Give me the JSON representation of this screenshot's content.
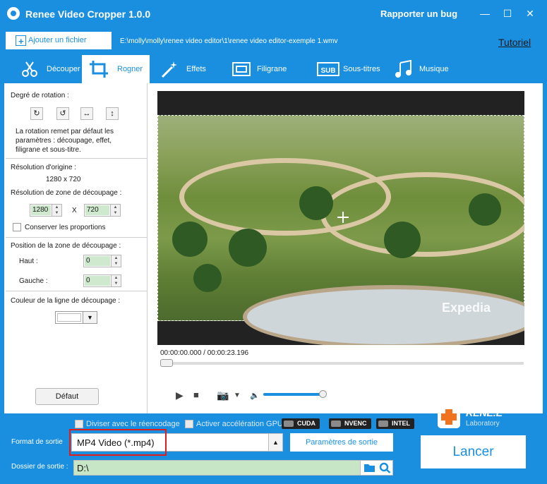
{
  "titlebar": {
    "title": "Renee Video Cropper 1.0.0",
    "bug_link": "Rapporter un bug",
    "buttons": [
      "minimize-icon",
      "maximize-icon",
      "close-icon"
    ]
  },
  "file_row": {
    "add_file": "Ajouter un fichier",
    "path": "E:\\molly\\molly\\renee video editor\\1\\renee video editor-exemple 1.wmv",
    "tutorial": "Tutoriel"
  },
  "tabs": [
    {
      "label": "Découper",
      "icon": "scissors-icon"
    },
    {
      "label": "Rogner",
      "icon": "crop-icon",
      "active": true
    },
    {
      "label": "Effets",
      "icon": "magic-wand-icon"
    },
    {
      "label": "Filigrane",
      "icon": "watermark-icon"
    },
    {
      "label": "Sous-titres",
      "icon": "subtitle-icon"
    },
    {
      "label": "Musique",
      "icon": "music-note-icon"
    }
  ],
  "sidebar": {
    "rotation_label": "Degré de rotation :",
    "rotation_note": "La rotation remet par défaut les paramètres : découpage, effet, filigrane et sous-titre.",
    "orig_res_label": "Résolution d'origine :",
    "orig_res_value": "1280 x 720",
    "crop_res_label": "Résolution de zone de découpage :",
    "crop_width": "1280",
    "crop_height": "720",
    "x_sep": "X",
    "keep_ratio": "Conserver les proportions",
    "position_label": "Position de la zone de découpage :",
    "top_label": "Haut :",
    "top_value": "0",
    "left_label": "Gauche :",
    "left_value": "0",
    "line_color_label": "Couleur de la ligne de découpage :",
    "default_button": "Défaut"
  },
  "player": {
    "watermark": "Expedia",
    "time": "00:00:00.000 / 00:00:23.196",
    "progress": 0,
    "volume": 0.85
  },
  "options": {
    "split_reencode": "Diviser avec le réencodage",
    "gpu_accel": "Activer accélération GPU",
    "gpu_badges": [
      "CUDA",
      "NVENC",
      "INTEL"
    ]
  },
  "brand": {
    "name": "RENE.E",
    "sub": "Laboratory"
  },
  "output": {
    "format_label": "Format de sortie",
    "format_value": "MP4 Video (*.mp4)",
    "params_button": "Paramètres de sortie",
    "folder_label": "Dossier de sortie :",
    "folder_value": "D:\\",
    "launch": "Lancer"
  }
}
